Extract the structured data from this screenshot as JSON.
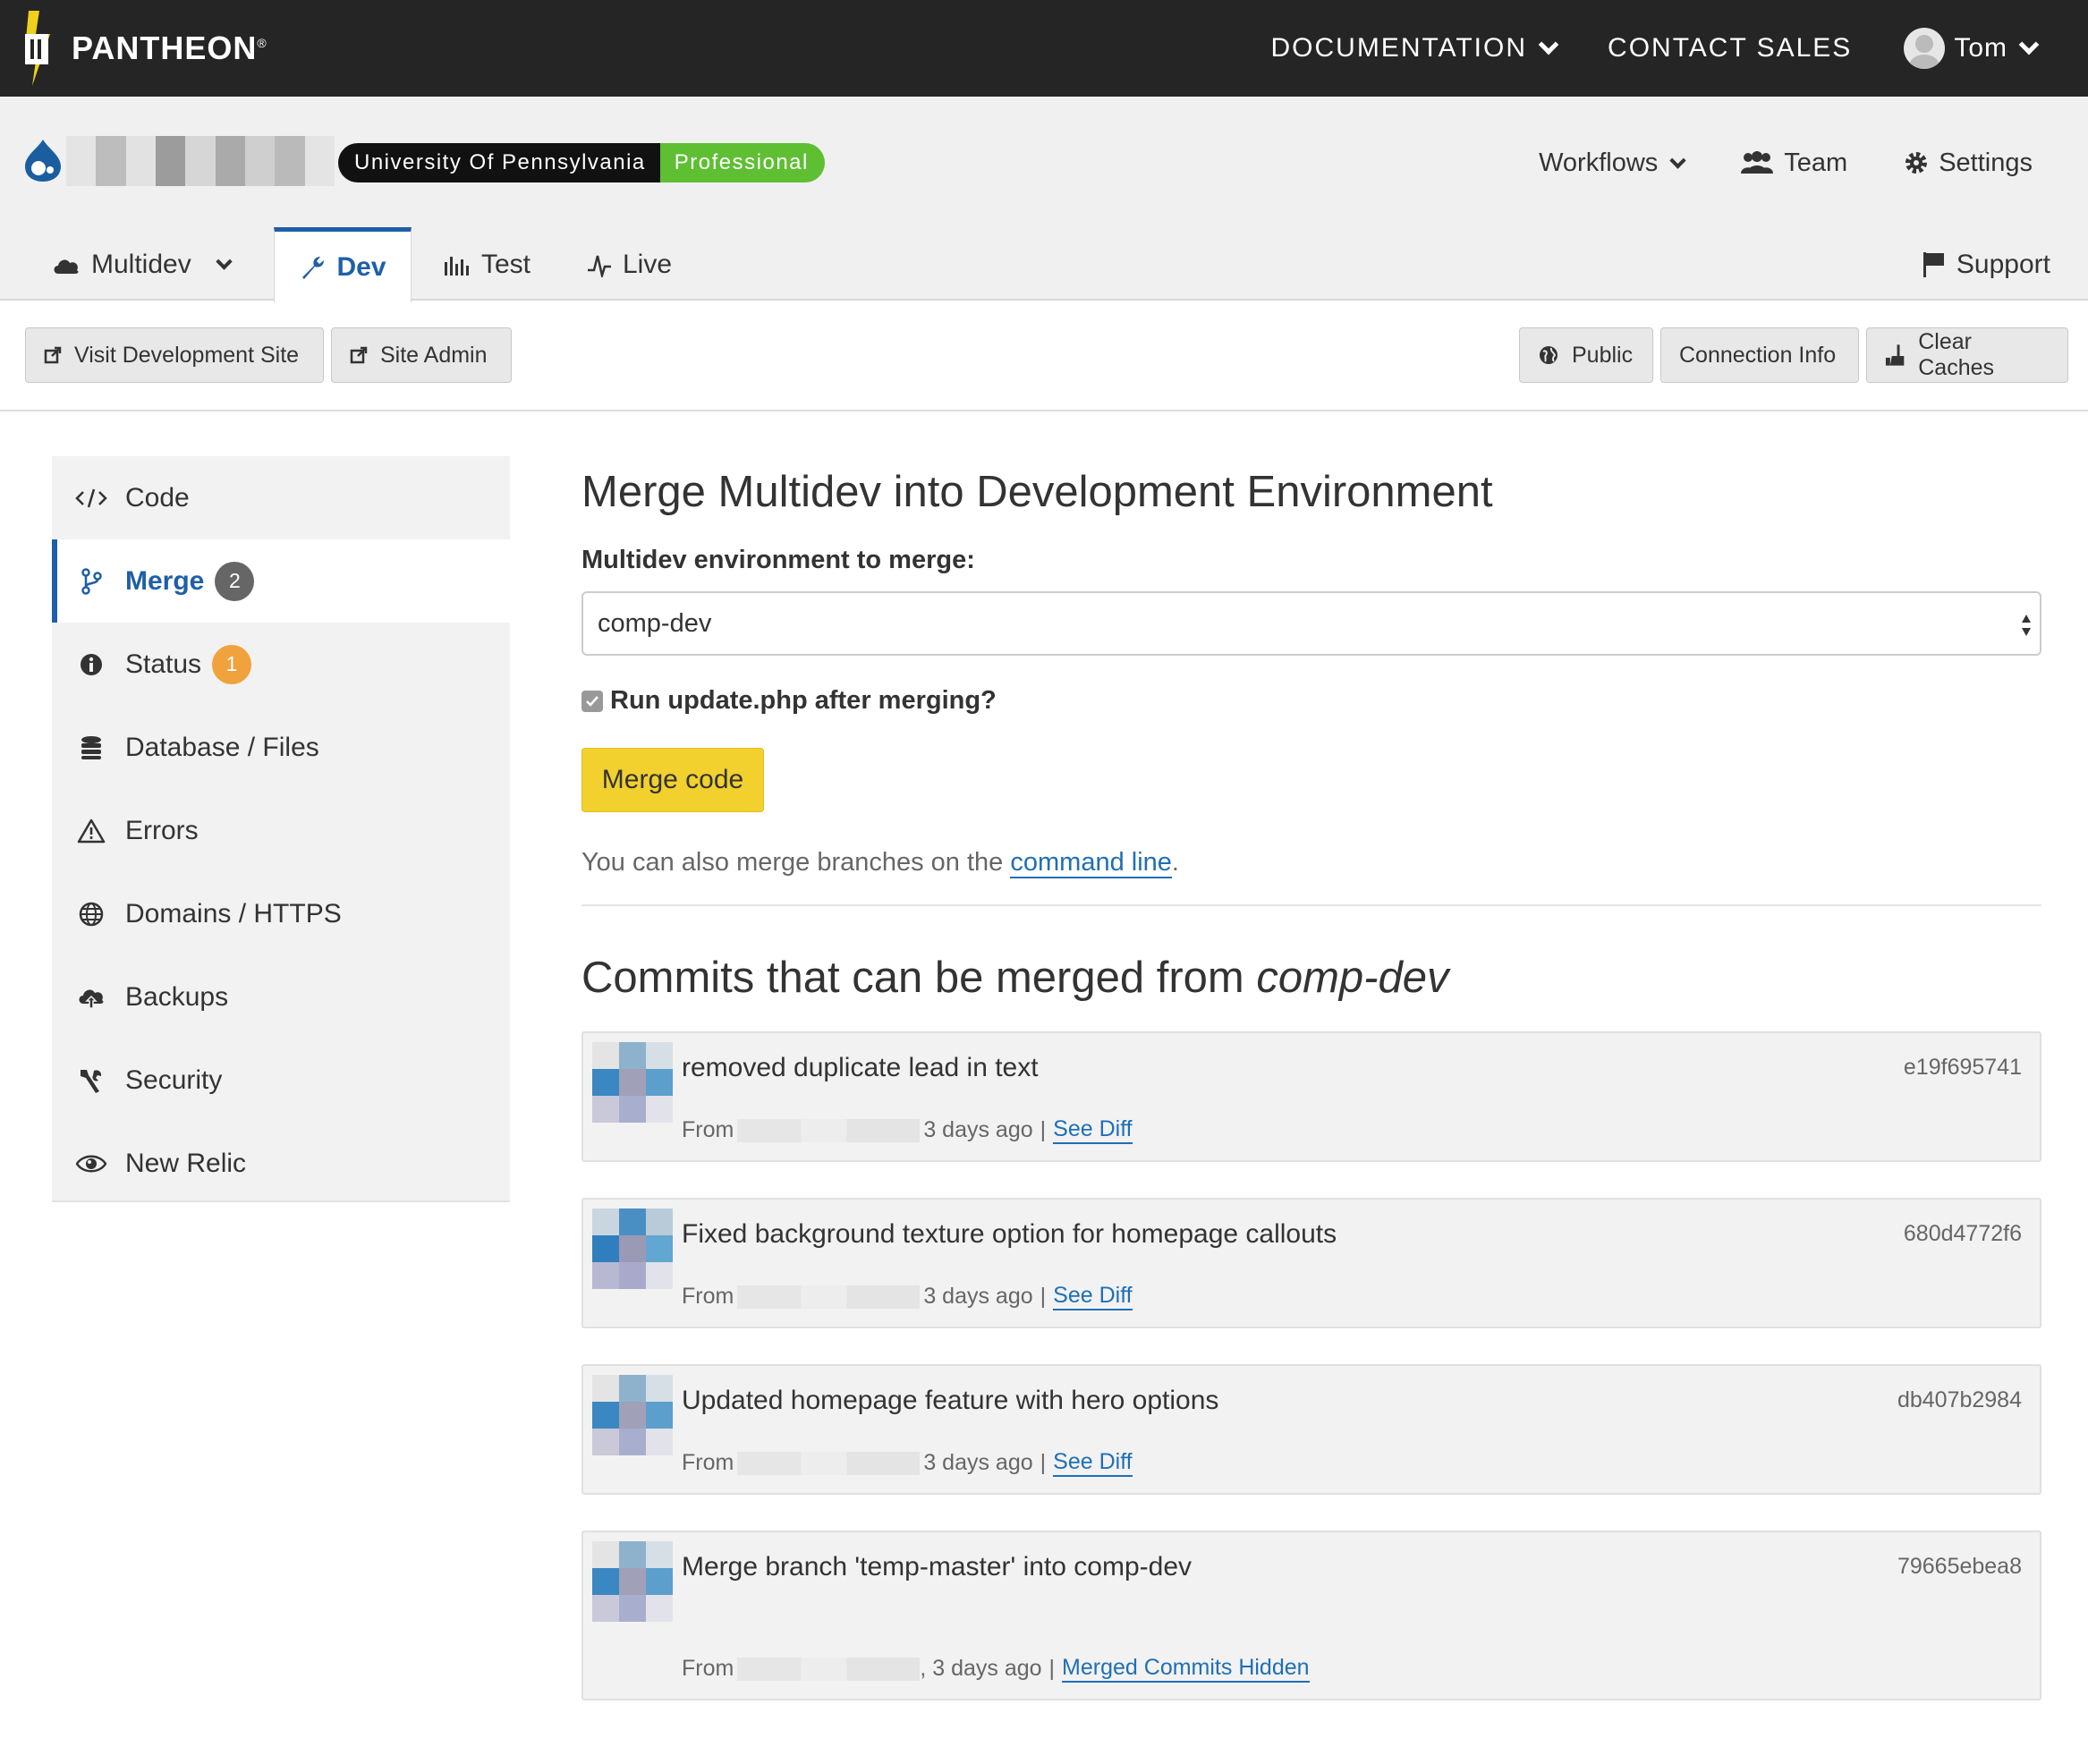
{
  "topbar": {
    "brand": "PANTHEON",
    "brand_mark": "®",
    "nav": {
      "documentation": "DOCUMENTATION",
      "contact_sales": "CONTACT SALES",
      "user_name": "Tom"
    }
  },
  "site": {
    "org": "University Of Pennsylvania",
    "plan": "Professional",
    "actions": {
      "workflows": "Workflows",
      "team": "Team",
      "settings": "Settings"
    }
  },
  "env_tabs": {
    "multidev": "Multidev",
    "dev": "Dev",
    "test": "Test",
    "live": "Live",
    "support": "Support"
  },
  "toolbar": {
    "visit_dev": "Visit Development Site",
    "site_admin": "Site Admin",
    "public": "Public",
    "connection_info": "Connection Info",
    "clear_caches": "Clear Caches"
  },
  "sidebar": {
    "items": [
      {
        "label": "Code"
      },
      {
        "label": "Merge",
        "count": "2"
      },
      {
        "label": "Status",
        "count": "1"
      },
      {
        "label": "Database / Files"
      },
      {
        "label": "Errors"
      },
      {
        "label": "Domains / HTTPS"
      },
      {
        "label": "Backups"
      },
      {
        "label": "Security"
      },
      {
        "label": "New Relic"
      }
    ]
  },
  "main": {
    "title": "Merge Multidev into Development Environment",
    "select_label": "Multidev environment to merge:",
    "selected_env": "comp-dev",
    "checkbox_label": "Run update.php after merging?",
    "merge_button": "Merge code",
    "hint_prefix": "You can also merge branches on the ",
    "hint_link": "command line",
    "hint_suffix": ".",
    "commits_title_prefix": "Commits that can be merged from ",
    "commits_title_env": "comp-dev",
    "commits": [
      {
        "message": "removed duplicate lead in text",
        "hash": "e19f695741",
        "from": "From",
        "age": "3 days ago",
        "sep": "|",
        "link": "See Diff"
      },
      {
        "message": "Fixed background texture option for homepage callouts",
        "hash": "680d4772f6",
        "from": "From",
        "age": "3 days ago",
        "sep": "|",
        "link": "See Diff"
      },
      {
        "message": "Updated homepage feature with hero options",
        "hash": "db407b2984",
        "from": "From",
        "age": "3 days ago",
        "sep": "|",
        "link": "See Diff"
      },
      {
        "message": "Merge branch 'temp-master' into comp-dev",
        "hash": "79665ebea8",
        "from": "From",
        "age": ", 3 days ago",
        "sep": "|",
        "link": "Merged Commits Hidden"
      }
    ]
  },
  "colors": {
    "topbar_bg": "#252525",
    "accent_blue": "#1f5fa6",
    "plan_green": "#5fbf33",
    "merge_yellow": "#f2d02d",
    "badge_gray": "#666666",
    "badge_orange": "#f0a23c"
  },
  "icons": {
    "logo": "pantheon-logo-icon",
    "drupal": "drupal-drop-icon",
    "user": "user-avatar-icon"
  }
}
